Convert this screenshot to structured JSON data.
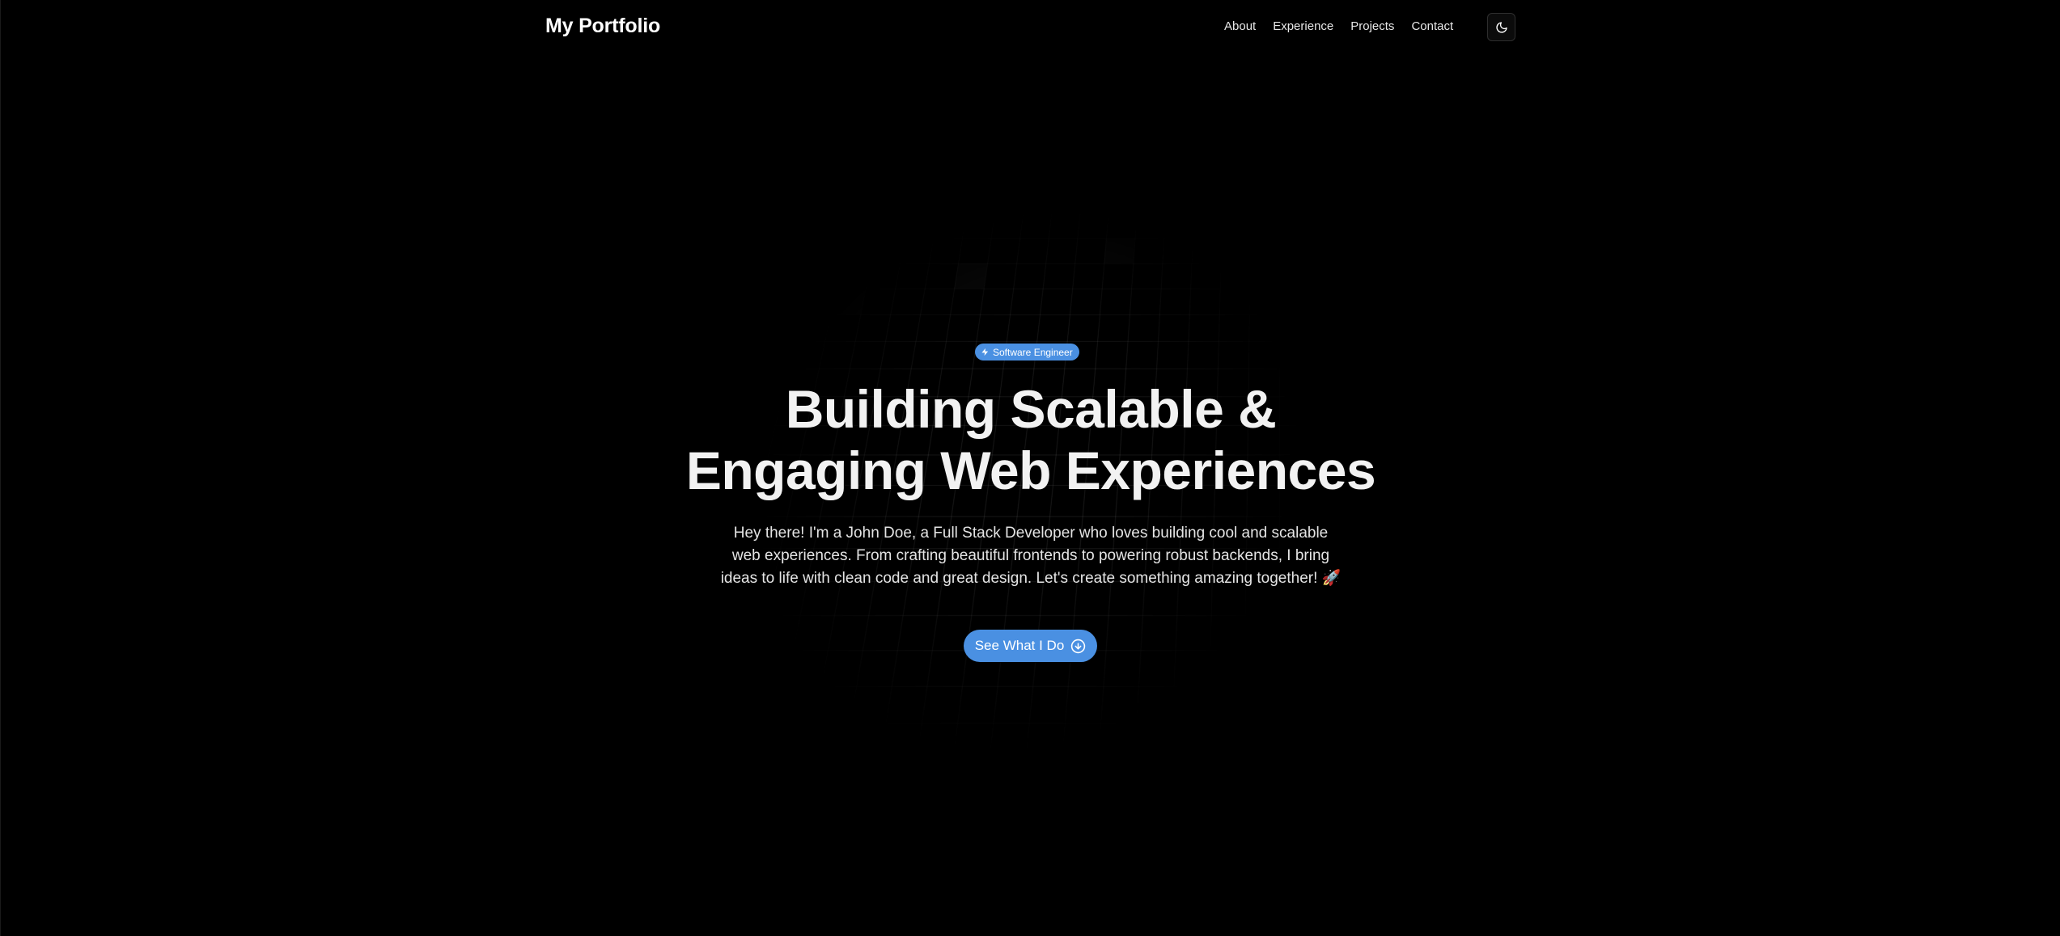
{
  "nav": {
    "brand": "My Portfolio",
    "links": [
      "About",
      "Experience",
      "Projects",
      "Contact"
    ],
    "theme_icon": "moon-icon"
  },
  "hero": {
    "badge_icon": "lightning-icon",
    "badge": "Software Engineer",
    "title_line1": "Building Scalable &",
    "title_line2": "Engaging Web Experiences",
    "description": "Hey there! I'm a John Doe, a Full Stack Developer who loves building cool and scalable web experiences. From crafting beautiful frontends to powering robust backends, I bring ideas to life with clean code and great design. Let's create something amazing together! 🚀",
    "cta_label": "See What I Do",
    "cta_icon": "arrow-down-circle-icon"
  },
  "colors": {
    "background": "#000000",
    "accent": "#4a90e2",
    "text": "#ffffff"
  }
}
